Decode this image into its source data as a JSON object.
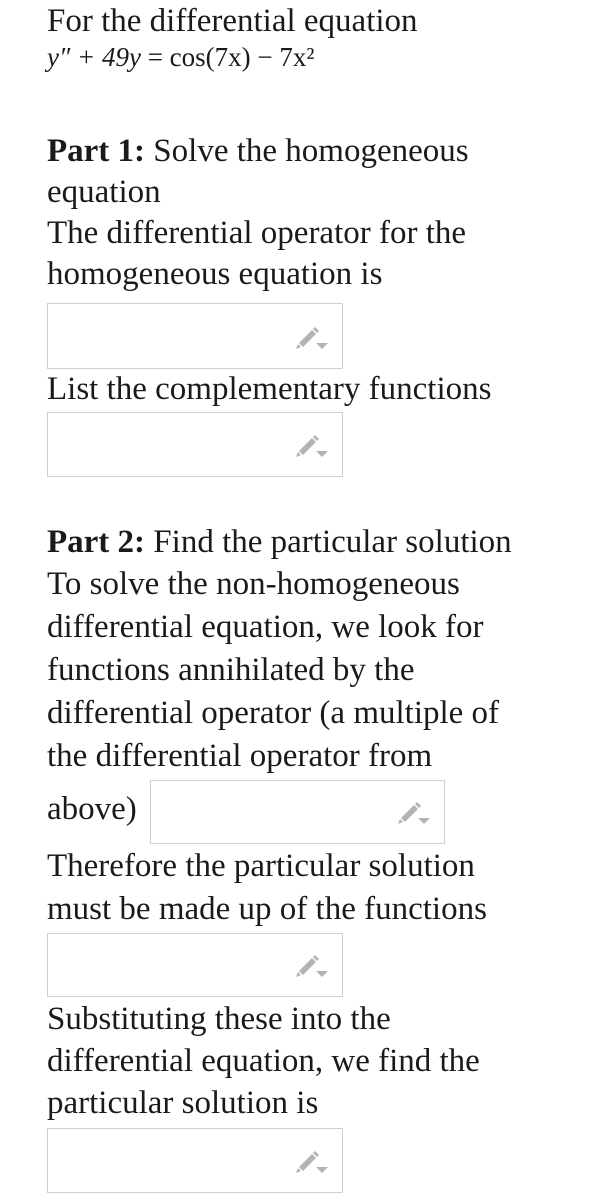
{
  "intro": "For the differential equation",
  "equation": {
    "lhs": "y″ + 49y",
    "eq": "=",
    "rhs": "cos(7x) − 7x²"
  },
  "part1": {
    "heading": "Part 1:",
    "heading_rest": " Solve the homogeneous",
    "line2": "equation",
    "line3": "The differential operator for the",
    "line4": "homogeneous equation is",
    "input1": {
      "value": ""
    },
    "label_complementary": "List the complementary functions",
    "input2": {
      "value": ""
    }
  },
  "part2": {
    "heading": "Part 2:",
    "heading_rest": " Find the particular solution",
    "lines": [
      "To solve the non-homogeneous",
      "differential equation, we look for",
      "functions annihilated by the",
      "differential operator (a multiple of",
      "the differential operator from"
    ],
    "above": "above)",
    "input3": {
      "value": ""
    },
    "therefore_lines": [
      "Therefore the particular solution",
      "must be made up of the functions"
    ],
    "input4": {
      "value": ""
    },
    "subst_lines": [
      "Substituting these into the",
      "differential equation, we find the",
      "particular solution is"
    ],
    "input5": {
      "value": ""
    }
  },
  "icons": {
    "edit": "pencil-dropdown-icon"
  },
  "colors": {
    "border": "#cfcfcf",
    "icon": "#b3b3b3",
    "text": "#1a1a1a"
  }
}
